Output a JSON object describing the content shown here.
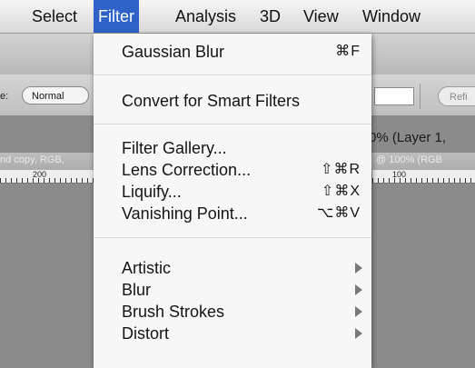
{
  "menubar": {
    "items": [
      {
        "label": "Select",
        "active": false
      },
      {
        "label": "Filter",
        "active": true
      },
      {
        "label": "Analysis",
        "active": false
      },
      {
        "label": "3D",
        "active": false
      },
      {
        "label": "View",
        "active": false
      },
      {
        "label": "Window",
        "active": false
      }
    ]
  },
  "options_bar": {
    "mode_label": "e:",
    "mode_value": "Normal",
    "refine_label": "Refi"
  },
  "document": {
    "title_right": "0% (Layer 1,",
    "tab_left": "nd copy, RGB,",
    "tab_right": "@ 100% (RGB",
    "ruler_left_number": "200",
    "ruler_right_number": "100"
  },
  "filter_menu": {
    "groups": [
      [
        {
          "label": "Gaussian Blur",
          "shortcut": "⌘F"
        }
      ],
      [
        {
          "label": "Convert for Smart Filters",
          "shortcut": ""
        }
      ],
      [
        {
          "label": "Filter Gallery...",
          "shortcut": ""
        },
        {
          "label": "Lens Correction...",
          "shortcut": "⇧⌘R"
        },
        {
          "label": "Liquify...",
          "shortcut": "⇧⌘X"
        },
        {
          "label": "Vanishing Point...",
          "shortcut": "⌥⌘V"
        }
      ],
      [
        {
          "label": "Artistic",
          "submenu": true
        },
        {
          "label": "Blur",
          "submenu": true
        },
        {
          "label": "Brush Strokes",
          "submenu": true
        },
        {
          "label": "Distort",
          "submenu": true
        }
      ]
    ]
  },
  "colors": {
    "menu_highlight": "#2f62c8",
    "menu_background": "#f7f7f7"
  }
}
